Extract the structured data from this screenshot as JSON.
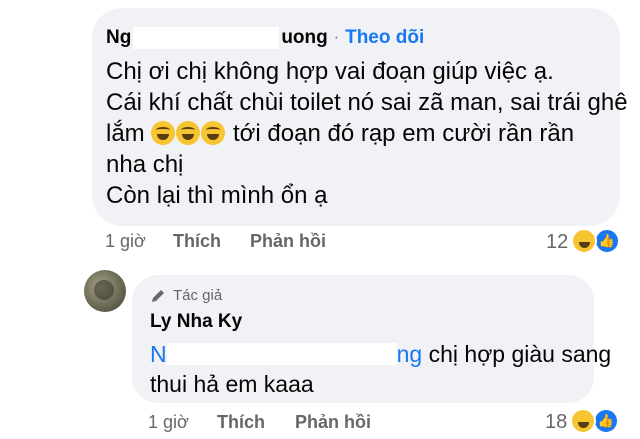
{
  "comment": {
    "author_prefix": "Ng",
    "author_suffix": "uong",
    "separator": "·",
    "follow_label": "Theo dõi",
    "lines": {
      "l1": "Chị ơi chị không hợp vai đoạn giúp việc ạ.",
      "l2": "Cái khí chất chùi toilet nó sai zã man, sai trái ghê",
      "l3_pre": "lắm ",
      "l3_post": " tới đoạn đó rạp em cười rần rần",
      "l4": "nha chị",
      "l5": "Còn lại thì mình ổn ạ"
    },
    "emoji": "rolling-on-floor-laughing",
    "time": "1 giờ",
    "like_label": "Thích",
    "reply_label": "Phản hồi",
    "reaction_count": "12",
    "reactions": [
      "haha",
      "like"
    ]
  },
  "reply": {
    "badge_label": "Tác giả",
    "author": "Ly Nha Ky",
    "mention_prefix": "N",
    "mention_suffix": "ng",
    "text_l1": " chị hợp giàu sang",
    "text_l2": "thui hả em kaaa",
    "time": "1 giờ",
    "like_label": "Thích",
    "reply_label": "Phản hồi",
    "reaction_count": "18",
    "reactions": [
      "haha",
      "like"
    ]
  },
  "colors": {
    "bubble": "#f0f2f5",
    "link": "#1877f2",
    "meta": "#65676b",
    "text": "#050505"
  }
}
